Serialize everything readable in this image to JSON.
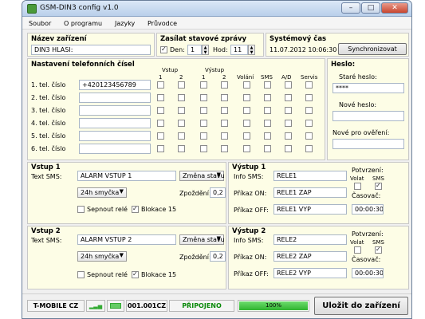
{
  "window": {
    "title": "GSM-DIN3 config v1.0",
    "min": "–",
    "max": "□",
    "close": "✕"
  },
  "menu": [
    "Soubor",
    "O programu",
    "Jazyky",
    "Průvodce"
  ],
  "device": {
    "name_label": "Název zařízení",
    "name_value": "DIN3 HLASI:"
  },
  "status_msg": {
    "title": "Zasílat stavové zprávy",
    "day_label": "Den:",
    "day_value": "1",
    "hour_label": "Hod:",
    "hour_value": "11",
    "enabled": true
  },
  "systime": {
    "title": "Systémový čas",
    "value": "11.07.2012 10:06:30",
    "sync_btn": "Synchronizovat"
  },
  "phones": {
    "title": "Nastavení telefonních čísel",
    "hdr_vstup": "Vstup",
    "hdr_vystup": "Výstup",
    "hdr_1a": "1",
    "hdr_2a": "2",
    "hdr_1b": "1",
    "hdr_2b": "2",
    "hdr_volani": "Volání",
    "hdr_sms": "SMS",
    "hdr_ad": "A/D",
    "hdr_servis": "Servis",
    "rows": [
      {
        "label": "1. tel. číslo",
        "value": "+420123456789"
      },
      {
        "label": "2. tel. číslo",
        "value": ""
      },
      {
        "label": "3. tel. číslo",
        "value": ""
      },
      {
        "label": "4. tel. číslo",
        "value": ""
      },
      {
        "label": "5. tel. číslo",
        "value": ""
      },
      {
        "label": "6. tel. číslo",
        "value": ""
      }
    ]
  },
  "password": {
    "title": "Heslo:",
    "old": "Staré heslo:",
    "old_value": "****",
    "new": "Nové heslo:",
    "confirm": "Nové pro ověření:"
  },
  "input1": {
    "title": "Vstup 1",
    "sms_label": "Text SMS:",
    "sms_value": "ALARM VSTUP 1",
    "mode": "Změna stavu",
    "loop": "24h smyčka",
    "delay_label": "Zpoždění:",
    "delay_value": "0,2",
    "relay": "Sepnout relé",
    "block": "Blokace 15",
    "block_checked": true
  },
  "input2": {
    "title": "Vstup 2",
    "sms_label": "Text SMS:",
    "sms_value": "ALARM VSTUP 2",
    "mode": "Změna stavu",
    "loop": "24h smyčka",
    "delay_label": "Zpoždění:",
    "delay_value": "0,2",
    "relay": "Sepnout relé",
    "block": "Blokace 15",
    "block_checked": true
  },
  "output1": {
    "title": "Výstup 1",
    "info_label": "Info SMS:",
    "info_value": "RELE1",
    "on_label": "Příkaz ON:",
    "on_value": "RELE1 ZAP",
    "off_label": "Příkaz OFF:",
    "off_value": "RELE1 VYP",
    "confirm": "Potvrzení:",
    "volat": "Volat",
    "sms": "SMS",
    "timer": "Časovač:",
    "timer_value": "00:00:30",
    "sms_checked": true
  },
  "output2": {
    "title": "Výstup 2",
    "info_label": "Info SMS:",
    "info_value": "RELE2",
    "on_label": "Příkaz ON:",
    "on_value": "RELE2 ZAP",
    "off_label": "Příkaz OFF:",
    "off_value": "RELE2 VYP",
    "confirm": "Potvrzení:",
    "volat": "Volat",
    "sms": "SMS",
    "timer": "Časovač:",
    "timer_value": "00:00:30",
    "sms_checked": true
  },
  "statusbar": {
    "operator": "T-MOBILE CZ",
    "fw": "001.001CZ",
    "conn": "PŘIPOJENO",
    "progress": "100%",
    "progress_value": 1.0,
    "upload_btn": "Uložit do zařízení"
  },
  "colors": {
    "panel": "#fdfde6",
    "connected": "#0a8a0a",
    "progress": "#2fb32f"
  }
}
